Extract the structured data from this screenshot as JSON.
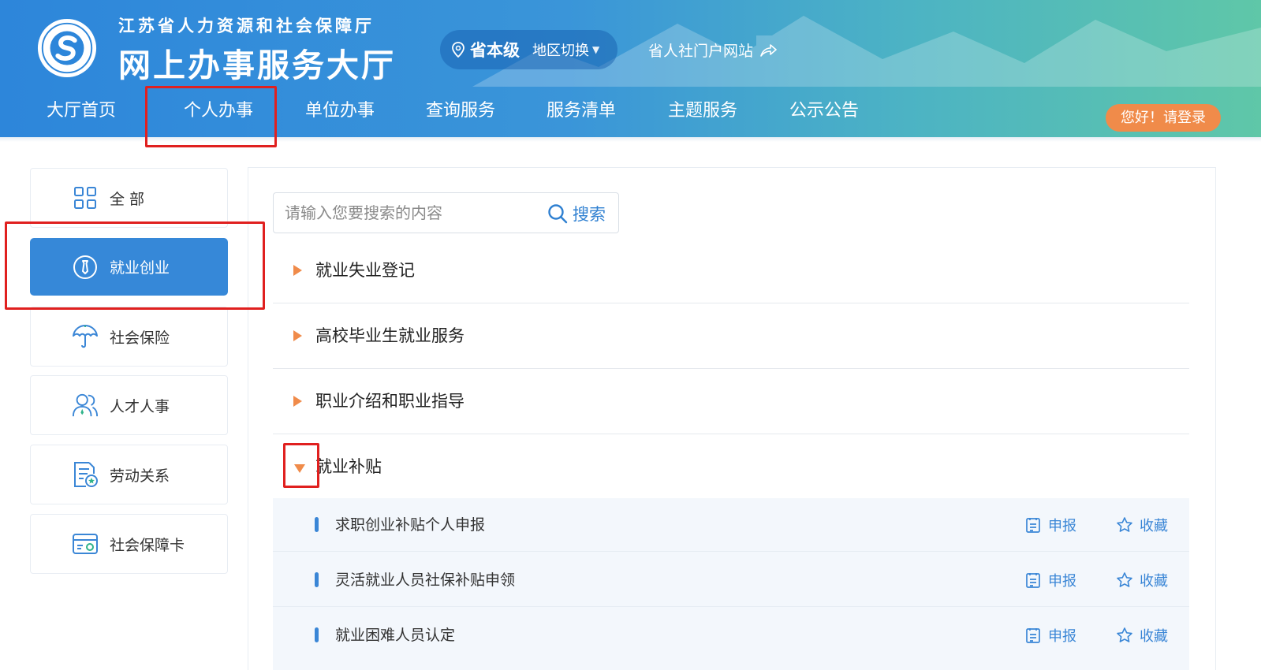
{
  "header": {
    "org_name": "江苏省人力资源和社会保障厅",
    "hall_name": "网上办事服务大厅",
    "region": {
      "level": "省本级",
      "switch_label": "地区切换"
    },
    "portal_link": "省人社门户网站",
    "login_label": "您好！请登录",
    "nav": [
      {
        "label": "大厅首页"
      },
      {
        "label": "个人办事"
      },
      {
        "label": "单位办事"
      },
      {
        "label": "查询服务"
      },
      {
        "label": "服务清单"
      },
      {
        "label": "主题服务"
      },
      {
        "label": "公示公告"
      }
    ]
  },
  "sidebar": {
    "items": [
      {
        "label": "全 部",
        "icon": "grid-icon"
      },
      {
        "label": "就业创业",
        "icon": "tie-icon",
        "active": true
      },
      {
        "label": "社会保险",
        "icon": "umbrella-icon"
      },
      {
        "label": "人才人事",
        "icon": "people-icon"
      },
      {
        "label": "劳动关系",
        "icon": "document-star-icon"
      },
      {
        "label": "社会保障卡",
        "icon": "card-icon"
      }
    ]
  },
  "search": {
    "placeholder": "请输入您要搜索的内容",
    "button_label": "搜索"
  },
  "categories": [
    {
      "label": "就业失业登记",
      "expanded": false
    },
    {
      "label": "高校毕业生就业服务",
      "expanded": false
    },
    {
      "label": "职业介绍和职业指导",
      "expanded": false
    },
    {
      "label": "就业补贴",
      "expanded": true
    }
  ],
  "sub_items": [
    {
      "label": "求职创业补贴个人申报",
      "apply_label": "申报",
      "fav_label": "收藏"
    },
    {
      "label": "灵活就业人员社保补贴申领",
      "apply_label": "申报",
      "fav_label": "收藏"
    },
    {
      "label": "就业困难人员认定",
      "apply_label": "申报",
      "fav_label": "收藏"
    }
  ],
  "colors": {
    "accent_blue": "#3688d8",
    "orange": "#f08b4a",
    "annotation_red": "#e0201f"
  }
}
